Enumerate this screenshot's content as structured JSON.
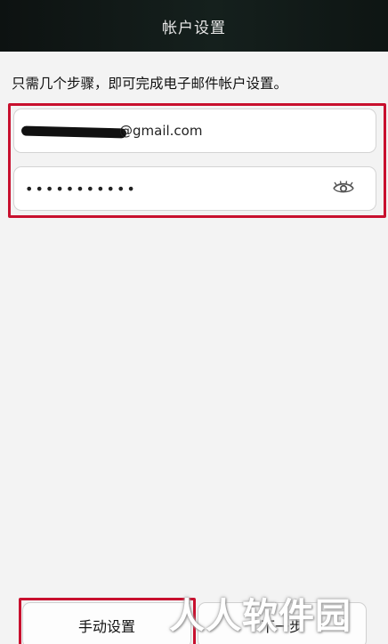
{
  "header": {
    "title": "帐户设置"
  },
  "instruction": "只需几个步骤，即可完成电子邮件帐户设置。",
  "email": {
    "visible_suffix": "@gmail.com"
  },
  "password": {
    "masked_value": "•••••••••••",
    "toggle_icon": "eye-icon"
  },
  "buttons": {
    "manual_label": "手动设置",
    "next_label": "下一步"
  },
  "watermark": "人人软件园",
  "colors": {
    "highlight": "#c8102e",
    "titlebar": "#0d1211"
  }
}
